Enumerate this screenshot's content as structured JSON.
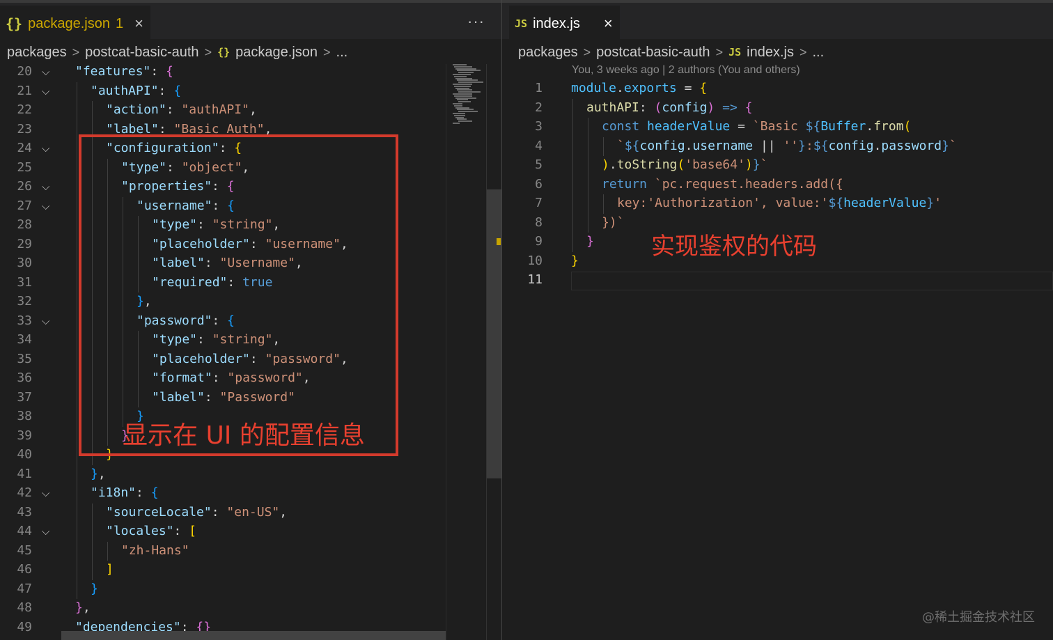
{
  "left": {
    "tab": {
      "icon": "{}",
      "label": "package.json",
      "badge": "1",
      "close": "×"
    },
    "more": "···",
    "breadcrumb": [
      "packages",
      "postcat-basic-auth",
      "package.json",
      "..."
    ],
    "crumb_file_icon": "{}",
    "line_numbers": [
      "20",
      "21",
      "22",
      "23",
      "24",
      "25",
      "26",
      "27",
      "28",
      "29",
      "30",
      "31",
      "32",
      "33",
      "34",
      "35",
      "36",
      "37",
      "38",
      "39",
      "40",
      "41",
      "42",
      "43",
      "44",
      "45",
      "46",
      "47",
      "48",
      "49"
    ],
    "fold_lines": [
      "20",
      "21",
      "24",
      "26",
      "27",
      "33",
      "42",
      "44"
    ],
    "code": [
      [
        [
          "k",
          "\"features\""
        ],
        [
          "pl",
          ": "
        ],
        [
          "b2",
          "{"
        ]
      ],
      [
        [
          "k",
          "\"authAPI\""
        ],
        [
          "pl",
          ": "
        ],
        [
          "b3",
          "{"
        ]
      ],
      [
        [
          "k",
          "\"action\""
        ],
        [
          "pl",
          ": "
        ],
        [
          "s",
          "\"authAPI\""
        ],
        [
          "pl",
          ","
        ]
      ],
      [
        [
          "k",
          "\"label\""
        ],
        [
          "pl",
          ": "
        ],
        [
          "s",
          "\"Basic Auth\""
        ],
        [
          "pl",
          ","
        ]
      ],
      [
        [
          "k",
          "\"configuration\""
        ],
        [
          "pl",
          ": "
        ],
        [
          "b1",
          "{"
        ]
      ],
      [
        [
          "k",
          "\"type\""
        ],
        [
          "pl",
          ": "
        ],
        [
          "s",
          "\"object\""
        ],
        [
          "pl",
          ","
        ]
      ],
      [
        [
          "k",
          "\"properties\""
        ],
        [
          "pl",
          ": "
        ],
        [
          "b2",
          "{"
        ]
      ],
      [
        [
          "k",
          "\"username\""
        ],
        [
          "pl",
          ": "
        ],
        [
          "b3",
          "{"
        ]
      ],
      [
        [
          "k",
          "\"type\""
        ],
        [
          "pl",
          ": "
        ],
        [
          "s",
          "\"string\""
        ],
        [
          "pl",
          ","
        ]
      ],
      [
        [
          "k",
          "\"placeholder\""
        ],
        [
          "pl",
          ": "
        ],
        [
          "s",
          "\"username\""
        ],
        [
          "pl",
          ","
        ]
      ],
      [
        [
          "k",
          "\"label\""
        ],
        [
          "pl",
          ": "
        ],
        [
          "s",
          "\"Username\""
        ],
        [
          "pl",
          ","
        ]
      ],
      [
        [
          "k",
          "\"required\""
        ],
        [
          "pl",
          ": "
        ],
        [
          "kw",
          "true"
        ]
      ],
      [
        [
          "b3",
          "}"
        ],
        [
          "pl",
          ","
        ]
      ],
      [
        [
          "k",
          "\"password\""
        ],
        [
          "pl",
          ": "
        ],
        [
          "b3",
          "{"
        ]
      ],
      [
        [
          "k",
          "\"type\""
        ],
        [
          "pl",
          ": "
        ],
        [
          "s",
          "\"string\""
        ],
        [
          "pl",
          ","
        ]
      ],
      [
        [
          "k",
          "\"placeholder\""
        ],
        [
          "pl",
          ": "
        ],
        [
          "s",
          "\"password\""
        ],
        [
          "pl",
          ","
        ]
      ],
      [
        [
          "k",
          "\"format\""
        ],
        [
          "pl",
          ": "
        ],
        [
          "s",
          "\"password\""
        ],
        [
          "pl",
          ","
        ]
      ],
      [
        [
          "k",
          "\"label\""
        ],
        [
          "pl",
          ": "
        ],
        [
          "s",
          "\"Password\""
        ]
      ],
      [
        [
          "b3",
          "}"
        ]
      ],
      [
        [
          "b2",
          "}"
        ]
      ],
      [
        [
          "b1",
          "}"
        ]
      ],
      [
        [
          "b3",
          "}"
        ],
        [
          "pl",
          ","
        ]
      ],
      [
        [
          "k",
          "\"i18n\""
        ],
        [
          "pl",
          ": "
        ],
        [
          "b3",
          "{"
        ]
      ],
      [
        [
          "k",
          "\"sourceLocale\""
        ],
        [
          "pl",
          ": "
        ],
        [
          "s",
          "\"en-US\""
        ],
        [
          "pl",
          ","
        ]
      ],
      [
        [
          "k",
          "\"locales\""
        ],
        [
          "pl",
          ": "
        ],
        [
          "b1",
          "["
        ]
      ],
      [
        [
          "s",
          "\"zh-Hans\""
        ]
      ],
      [
        [
          "b1",
          "]"
        ]
      ],
      [
        [
          "b3",
          "}"
        ]
      ],
      [
        [
          "b2",
          "}"
        ],
        [
          "pl",
          ","
        ]
      ],
      [
        [
          "k",
          "\"dependencies\""
        ],
        [
          "pl",
          ": "
        ],
        [
          "b2",
          "{}"
        ]
      ]
    ],
    "annotation": "显示在 UI 的配置信息"
  },
  "right": {
    "tab": {
      "icon": "JS",
      "label": "index.js",
      "close": "×"
    },
    "breadcrumb": [
      "packages",
      "postcat-basic-auth",
      "index.js",
      "..."
    ],
    "crumb_file_icon": "JS",
    "blame": "You, 3 weeks ago | 2 authors (You and others)",
    "line_numbers": [
      "1",
      "2",
      "3",
      "4",
      "5",
      "6",
      "7",
      "8",
      "9",
      "10",
      "11"
    ],
    "active_line": "11",
    "code": [
      [
        [
          "var",
          "module"
        ],
        [
          "pl",
          "."
        ],
        [
          "var",
          "exports"
        ],
        [
          "pl",
          " = "
        ],
        [
          "b1",
          "{"
        ]
      ],
      [
        [
          "fn",
          "authAPI"
        ],
        [
          "pl",
          ": "
        ],
        [
          "b2",
          "("
        ],
        [
          "k",
          "config"
        ],
        [
          "b2",
          ")"
        ],
        [
          "pl",
          " "
        ],
        [
          "kw",
          "=>"
        ],
        [
          "pl",
          " "
        ],
        [
          "b2",
          "{"
        ]
      ],
      [
        [
          "kw",
          "const "
        ],
        [
          "var",
          "headerValue"
        ],
        [
          "pl",
          " = "
        ],
        [
          "s",
          "`Basic "
        ],
        [
          "kw",
          "${"
        ],
        [
          "var",
          "Buffer"
        ],
        [
          "pl",
          "."
        ],
        [
          "fn",
          "from"
        ],
        [
          "b1",
          "("
        ]
      ],
      [
        [
          "s",
          "`"
        ],
        [
          "kw",
          "${"
        ],
        [
          "k",
          "config"
        ],
        [
          "pl",
          "."
        ],
        [
          "k",
          "username"
        ],
        [
          "pl",
          " || "
        ],
        [
          "s",
          "''"
        ],
        [
          "kw",
          "}"
        ],
        [
          "s",
          ":"
        ],
        [
          "kw",
          "${"
        ],
        [
          "k",
          "config"
        ],
        [
          "pl",
          "."
        ],
        [
          "k",
          "password"
        ],
        [
          "kw",
          "}"
        ],
        [
          "s",
          "`"
        ]
      ],
      [
        [
          "b1",
          ")"
        ],
        [
          "pl",
          "."
        ],
        [
          "fn",
          "toString"
        ],
        [
          "b1",
          "("
        ],
        [
          "s",
          "'base64'"
        ],
        [
          "b1",
          ")"
        ],
        [
          "kw",
          "}"
        ],
        [
          "s",
          "`"
        ]
      ],
      [
        [
          "kw",
          "return "
        ],
        [
          "s",
          "`pc.request.headers.add({"
        ]
      ],
      [
        [
          "s",
          "key:'Authorization', value:'"
        ],
        [
          "kw",
          "${"
        ],
        [
          "var",
          "headerValue"
        ],
        [
          "kw",
          "}"
        ],
        [
          "s",
          "'"
        ]
      ],
      [
        [
          "s",
          "})`"
        ]
      ],
      [
        [
          "b2",
          "}"
        ]
      ],
      [
        [
          "b1",
          "}"
        ]
      ],
      [
        [
          "pl",
          ""
        ]
      ]
    ],
    "annotation": "实现鉴权的代码"
  },
  "watermark": "@稀土掘金技术社区",
  "colors": {
    "annotation": "#e8402f",
    "box": "#d33a2c",
    "background": "#1e1e1e"
  }
}
